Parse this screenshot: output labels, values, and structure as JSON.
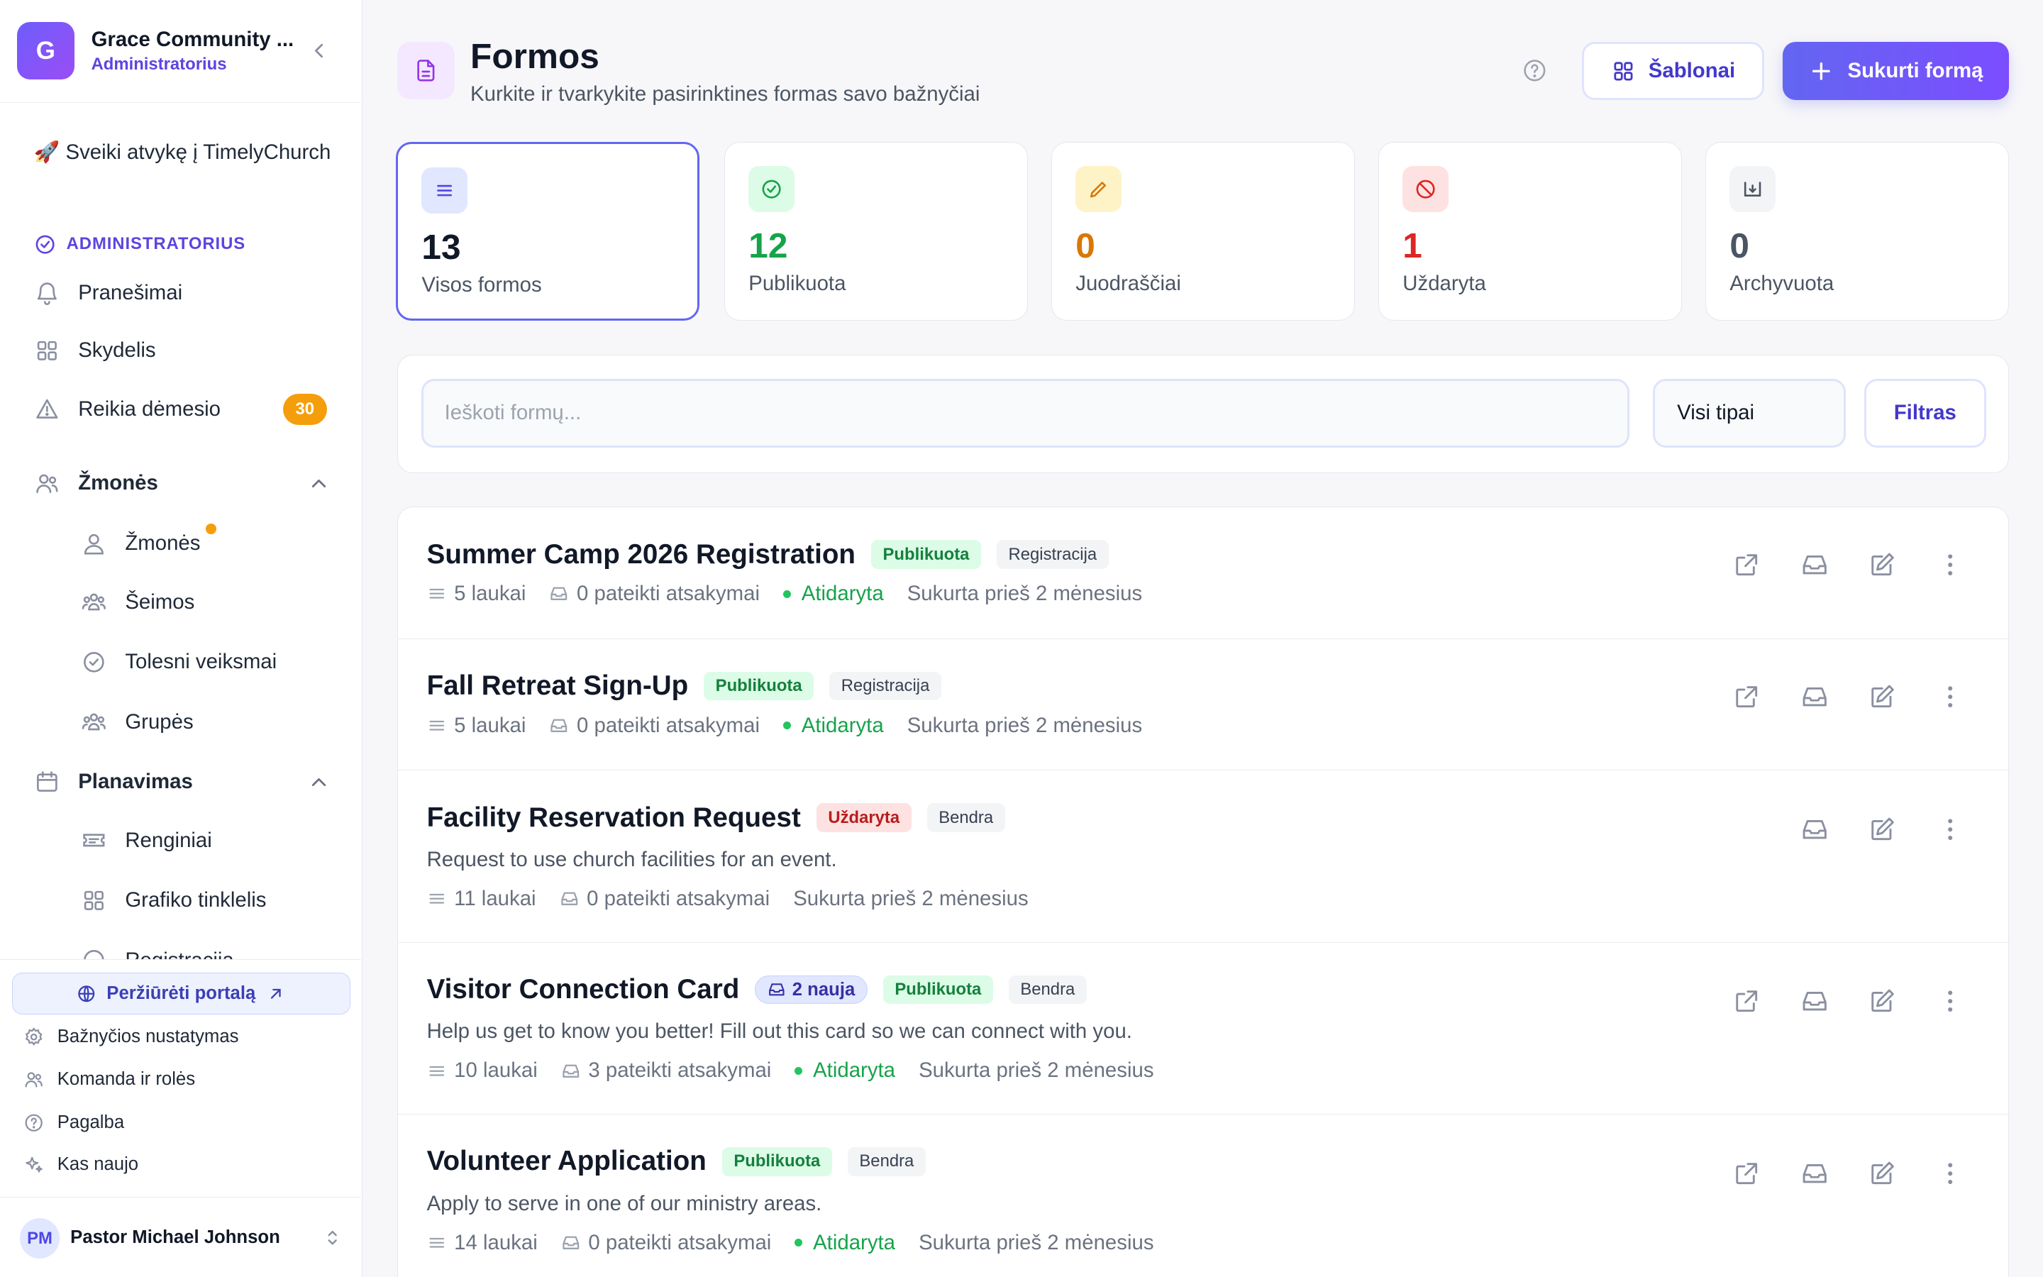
{
  "sidebar": {
    "org_initial": "G",
    "org_name": "Grace Community ...",
    "org_role": "Administratorius",
    "welcome": "🚀 Sveiki atvykę į TimelyChurch",
    "role_label": "ADMINISTRATORIUS",
    "items": {
      "notifications": "Pranešimai",
      "dashboard": "Skydelis",
      "attention": "Reikia dėmesio",
      "attention_count": "30"
    },
    "people_section": "Žmonės",
    "people_items": [
      "Žmonės",
      "Šeimos",
      "Tolesni veiksmai",
      "Grupės"
    ],
    "planning_section": "Planavimas",
    "planning_items": [
      "Renginiai",
      "Grafiko tinklelis",
      "Registracija"
    ],
    "portal_button": "Peržiūrėti portalą",
    "bottom_links": [
      "Bažnyčios nustatymas",
      "Komanda ir rolės",
      "Pagalba",
      "Kas naujo"
    ],
    "user_initials": "PM",
    "user_name": "Pastor Michael Johnson"
  },
  "header": {
    "title": "Formos",
    "subtitle": "Kurkite ir tvarkykite pasirinktines formas savo bažnyčiai",
    "templates_button": "Šablonai",
    "create_button": "Sukurti formą"
  },
  "stats": [
    {
      "value": "13",
      "label": "Visos formos",
      "color": "#111827"
    },
    {
      "value": "12",
      "label": "Publikuota",
      "color": "#16a34a"
    },
    {
      "value": "0",
      "label": "Juodraščiai",
      "color": "#d97706"
    },
    {
      "value": "1",
      "label": "Uždaryta",
      "color": "#dc2626"
    },
    {
      "value": "0",
      "label": "Archyvuota",
      "color": "#4b5563"
    }
  ],
  "search": {
    "placeholder": "Ieškoti formų...",
    "type_select": "Visi tipai",
    "filter_button": "Filtras"
  },
  "forms": [
    {
      "title": "Summer Camp 2026 Registration",
      "status": "Publikuota",
      "type": "Registracija",
      "description": "",
      "fields": "5 laukai",
      "responses": "0 pateikti atsakymai",
      "open": "Atidaryta",
      "created": "Sukurta prieš 2 mėnesius"
    },
    {
      "title": "Fall Retreat Sign-Up",
      "status": "Publikuota",
      "type": "Registracija",
      "description": "",
      "fields": "5 laukai",
      "responses": "0 pateikti atsakymai",
      "open": "Atidaryta",
      "created": "Sukurta prieš 2 mėnesius"
    },
    {
      "title": "Facility Reservation Request",
      "status": "Uždaryta",
      "type": "Bendra",
      "description": "Request to use church facilities for an event.",
      "fields": "11 laukai",
      "responses": "0 pateikti atsakymai",
      "open": "",
      "created": "Sukurta prieš 2 mėnesius"
    },
    {
      "title": "Visitor Connection Card",
      "new_badge": "2 nauja",
      "status": "Publikuota",
      "type": "Bendra",
      "description": "Help us get to know you better! Fill out this card so we can connect with you.",
      "fields": "10 laukai",
      "responses": "3 pateikti atsakymai",
      "open": "Atidaryta",
      "created": "Sukurta prieš 2 mėnesius"
    },
    {
      "title": "Volunteer Application",
      "status": "Publikuota",
      "type": "Bendra",
      "description": "Apply to serve in one of our ministry areas.",
      "fields": "14 laukai",
      "responses": "0 pateikti atsakymai",
      "open": "Atidaryta",
      "created": "Sukurta prieš 2 mėnesius"
    }
  ]
}
